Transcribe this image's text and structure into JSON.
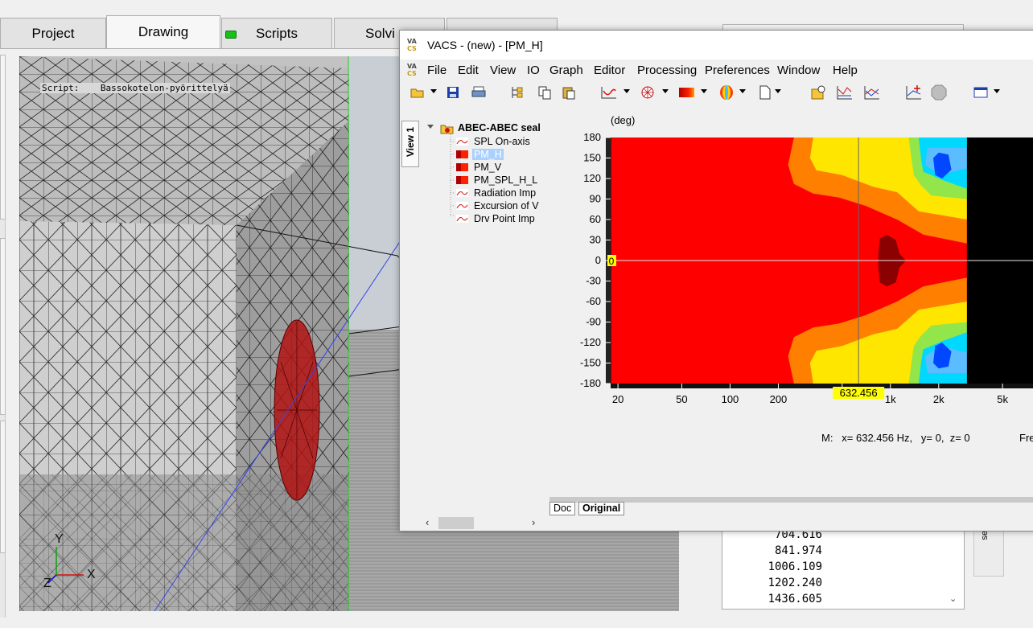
{
  "background_window": {
    "tabs": [
      {
        "label": "Project",
        "active": false
      },
      {
        "label": "Drawing",
        "active": true
      },
      {
        "label": "Scripts",
        "active": false,
        "indicator": "green-light"
      },
      {
        "label": "Solvi",
        "active": false
      },
      {
        "label": "",
        "active": false
      }
    ],
    "script_label": "Script:    Bassokotelon-pyörittelyä",
    "axis_labels": {
      "y": "Y",
      "z": "Z",
      "x": "X"
    },
    "results_list": [
      "704.616",
      "841.974",
      "1006.109",
      "1202.240",
      "1436.605"
    ],
    "side_tab_label": "se"
  },
  "vacs": {
    "title": "VACS - (new) - [PM_H]",
    "logo": {
      "top": "VA",
      "bottom": "CS"
    },
    "menu": [
      "File",
      "Edit",
      "View",
      "IO",
      "Graph",
      "Editor",
      "Processing",
      "Preferences",
      "Window",
      "Help"
    ],
    "toolbar_icons": [
      "open-folder-icon",
      "save-icon",
      "print-icon",
      "tree-icon",
      "copy-icon",
      "paste-icon",
      "line-graph-icon",
      "polar-graph-icon",
      "color-map-icon",
      "balloon-icon",
      "new-doc-icon",
      "script-icon",
      "bode-icon",
      "multi-graph-icon",
      "add-graph-icon",
      "stop-icon",
      "window-icon"
    ],
    "view_tab": "View 1",
    "tree": {
      "root": "ABEC-ABEC seal",
      "items": [
        {
          "label": "SPL On-axis",
          "type": "line",
          "selected": false
        },
        {
          "label": "PM_H",
          "type": "map",
          "selected": true
        },
        {
          "label": "PM_V",
          "type": "map",
          "selected": false
        },
        {
          "label": "PM_SPL_H_L",
          "type": "map",
          "selected": false
        },
        {
          "label": "Radiation Imp",
          "type": "line",
          "selected": false
        },
        {
          "label": "Excursion of V",
          "type": "line",
          "selected": false
        },
        {
          "label": "Drv Point Imp",
          "type": "line",
          "selected": false
        }
      ]
    },
    "doc_tabs": [
      {
        "label": "Doc",
        "active": false
      },
      {
        "label": "Original",
        "active": true
      }
    ],
    "status": "M:   x= 632.456 Hz,   y= 0,  z= 0",
    "status_right": "Fre",
    "colors": {
      "red": "#ff0000",
      "darkred": "#8b0000",
      "orange": "#ff7f00",
      "yellow": "#ffe600",
      "green": "#93e64a",
      "cyan": "#00d8ff",
      "lightblue": "#5bbcff",
      "blue": "#0047ff",
      "black": "#000000"
    }
  },
  "chart_data": {
    "type": "heatmap",
    "title": "",
    "xlabel": "",
    "ylabel": "(deg)",
    "x_scale": "log",
    "x_ticks": [
      {
        "value": 20,
        "label": "20"
      },
      {
        "value": 50,
        "label": "50"
      },
      {
        "value": 100,
        "label": "100"
      },
      {
        "value": 200,
        "label": "200"
      },
      {
        "value": 500,
        "label": ""
      },
      {
        "value": 1000,
        "label": "1k"
      },
      {
        "value": 2000,
        "label": "2k"
      },
      {
        "value": 5000,
        "label": "5k"
      }
    ],
    "y_ticks": [
      180,
      150,
      120,
      90,
      60,
      30,
      0,
      -30,
      -60,
      -90,
      -120,
      -150,
      -180
    ],
    "ylim": [
      -180,
      180
    ],
    "xlim": [
      18,
      9000
    ],
    "data_max_x": 3000,
    "cursor": {
      "x": 632.456,
      "y": 0,
      "x_label": "632.456",
      "y_label": "0"
    }
  }
}
